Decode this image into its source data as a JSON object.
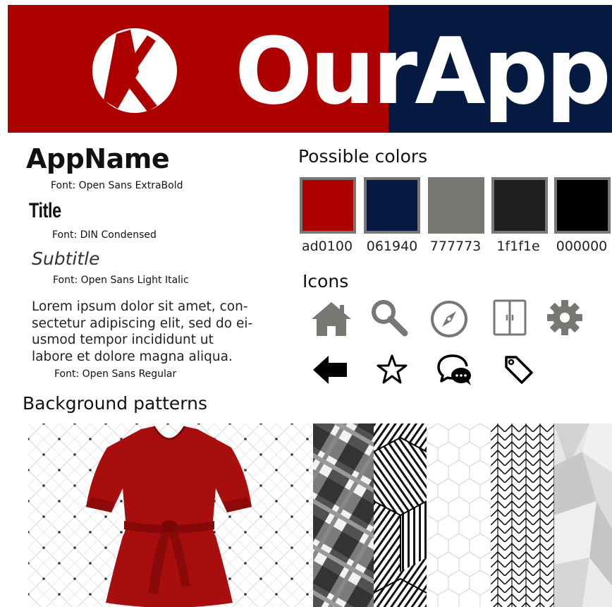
{
  "banner": {
    "title": "OurApp",
    "logo_icon": "circle-k-logo",
    "colors": {
      "left": "#ad0100",
      "right": "#061940"
    }
  },
  "typography": {
    "app_name": "AppName",
    "app_name_font": "Font: Open Sans ExtraBold",
    "title": "Title",
    "title_font": "Font: DIN Condensed",
    "subtitle": "Subtitle",
    "subtitle_font": "Font: Open Sans Light Italic",
    "body": "Lorem ipsum dolor sit amet, con- sectetur adipiscing elit, sed do ei- usmod tempor incididunt ut labore et dolore magna aliqua.",
    "body_font": "Font: Open Sans Regular"
  },
  "colors": {
    "heading": "Possible colors",
    "swatches": [
      {
        "hex": "#ad0100",
        "label": "ad0100"
      },
      {
        "hex": "#061940",
        "label": "061940"
      },
      {
        "hex": "#777773",
        "label": "777773"
      },
      {
        "hex": "#1f1f1e",
        "label": "1f1f1e"
      },
      {
        "hex": "#000000",
        "label": "000000"
      }
    ]
  },
  "icons": {
    "heading": "Icons",
    "items": [
      "home-icon",
      "search-icon",
      "compass-icon",
      "wardrobe-icon",
      "gear-icon",
      "back-arrow-icon",
      "star-icon",
      "chat-bubbles-icon",
      "tag-icon"
    ]
  },
  "patterns": {
    "heading": "Background patterns",
    "items": [
      "diamond-grid-pattern",
      "red-shirt-photo",
      "plaid-pattern",
      "striped-cubes-pattern",
      "hexagon-pattern",
      "herringbone-pattern",
      "grey-polygon-pattern"
    ]
  }
}
